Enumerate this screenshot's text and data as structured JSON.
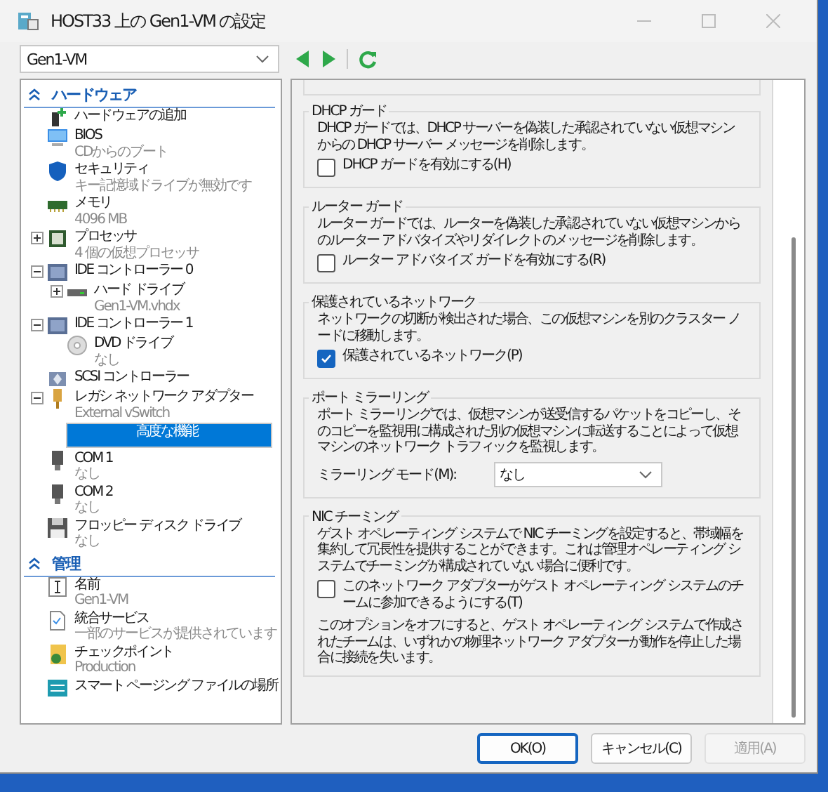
{
  "window": {
    "title": "HOST33 上の Gen1-VM の設定"
  },
  "vm_select": {
    "value": "Gen1-VM"
  },
  "tree": [
    {
      "heading": "ハードウェア",
      "expanded": true,
      "items": [
        {
          "label": "ハードウェアの追加",
          "kind": "add",
          "selected": false
        },
        {
          "label": "BIOS",
          "detail": "CDからのブート",
          "kind": "bios",
          "selected": false
        },
        {
          "label": "セキュリティ",
          "detail": "キー記憶域ドライブが無効です",
          "kind": "security",
          "selected": false
        },
        {
          "label": "メモリ",
          "detail": "4096 MB",
          "kind": "memory",
          "selected": false
        },
        {
          "label": "プロセッサ",
          "detail": "4 個の仮想プロセッサ",
          "kind": "processor",
          "expanded": false,
          "selected": false
        },
        {
          "label": "IDE コントローラー 0",
          "kind": "controller",
          "expanded": true,
          "selected": false,
          "children": [
            {
              "label": "ハード ドライブ",
              "detail": "Gen1-VM.vhdx",
              "kind": "disk",
              "expanded": false,
              "selected": false
            }
          ]
        },
        {
          "label": "IDE コントローラー 1",
          "kind": "controller",
          "expanded": true,
          "selected": false,
          "children": [
            {
              "label": "DVD ドライブ",
              "detail": "なし",
              "kind": "dvd",
              "selected": false
            }
          ]
        },
        {
          "label": "SCSI コントローラー",
          "kind": "scsi",
          "selected": false
        },
        {
          "label": "レガシ ネットワーク アダプター",
          "detail": "External vSwitch",
          "kind": "nic",
          "expanded": true,
          "selected": false,
          "children": [
            {
              "label": "高度な機能",
              "kind": "none",
              "selected": true
            }
          ]
        },
        {
          "label": "COM 1",
          "detail": "なし",
          "kind": "com",
          "selected": false
        },
        {
          "label": "COM 2",
          "detail": "なし",
          "kind": "com",
          "selected": false
        },
        {
          "label": "フロッピー ディスク ドライブ",
          "detail": "なし",
          "kind": "floppy",
          "selected": false
        }
      ]
    },
    {
      "heading": "管理",
      "expanded": true,
      "items": [
        {
          "label": "名前",
          "detail": "Gen1-VM",
          "kind": "name",
          "selected": false
        },
        {
          "label": "統合サービス",
          "detail": "一部のサービスが提供されています",
          "kind": "integration",
          "selected": false
        },
        {
          "label": "チェックポイント",
          "detail": "Production",
          "kind": "checkpoint",
          "selected": false
        },
        {
          "label": "スマート ページング ファイルの場所",
          "kind": "paging",
          "selected": false
        }
      ]
    }
  ],
  "groups": [
    {
      "title": "DHCP ガード",
      "items": [
        {
          "kind": "text",
          "text": "DHCP ガードでは、DHCP サーバーを偽装した承認されていない仮想マシンからの DHCP サーバー メッセージを削除します。"
        },
        {
          "kind": "checkbox",
          "label": "DHCP ガードを有効にする(H)",
          "checked": false
        }
      ]
    },
    {
      "title": "ルーター ガード",
      "items": [
        {
          "kind": "text",
          "text": "ルーター ガードでは、ルーターを偽装した承認されていない仮想マシンからのルーター アドバタイズやリダイレクトのメッセージを削除します。"
        },
        {
          "kind": "checkbox",
          "label": "ルーター アドバタイズ ガードを有効にする(R)",
          "checked": false
        }
      ]
    },
    {
      "title": "保護されているネットワーク",
      "items": [
        {
          "kind": "text",
          "text": "ネットワークの切断が検出された場合、この仮想マシンを別のクラスター ノードに移動します。"
        },
        {
          "kind": "checkbox",
          "label": "保護されているネットワーク(P)",
          "checked": true
        }
      ]
    },
    {
      "title": "ポート ミラーリング",
      "items": [
        {
          "kind": "text",
          "text": "ポート ミラーリングでは、仮想マシンが送受信するパケットをコピーし、そのコピーを監視用に構成された別の仮想マシンに転送することによって仮想マシンのネットワーク トラフィックを監視します。"
        },
        {
          "kind": "select",
          "label": "ミラーリング モード(M):",
          "value": "なし"
        }
      ]
    },
    {
      "title": "NIC チーミング",
      "items": [
        {
          "kind": "text",
          "text": "ゲスト オペレーティング システムで NIC チーミングを設定すると、帯域幅を集約して冗長性を提供することができます。これは管理オペレーティング システムでチーミングが構成されていない場合に便利です。"
        },
        {
          "kind": "checkbox",
          "label": "このネットワーク アダプターがゲスト オペレーティング システムのチームに参加できるようにする(T)",
          "checked": false
        },
        {
          "kind": "text",
          "text": "このオプションをオフにすると、ゲスト オペレーティング システムで作成されたチームは、いずれかの物理ネットワーク アダプターが動作を停止した場合に接続を失います。"
        }
      ]
    }
  ],
  "buttons": [
    {
      "label": "OK(O)",
      "default": true,
      "disabled": false
    },
    {
      "label": "キャンセル(C)",
      "default": false,
      "disabled": false
    },
    {
      "label": "適用(A)",
      "default": false,
      "disabled": true
    }
  ]
}
